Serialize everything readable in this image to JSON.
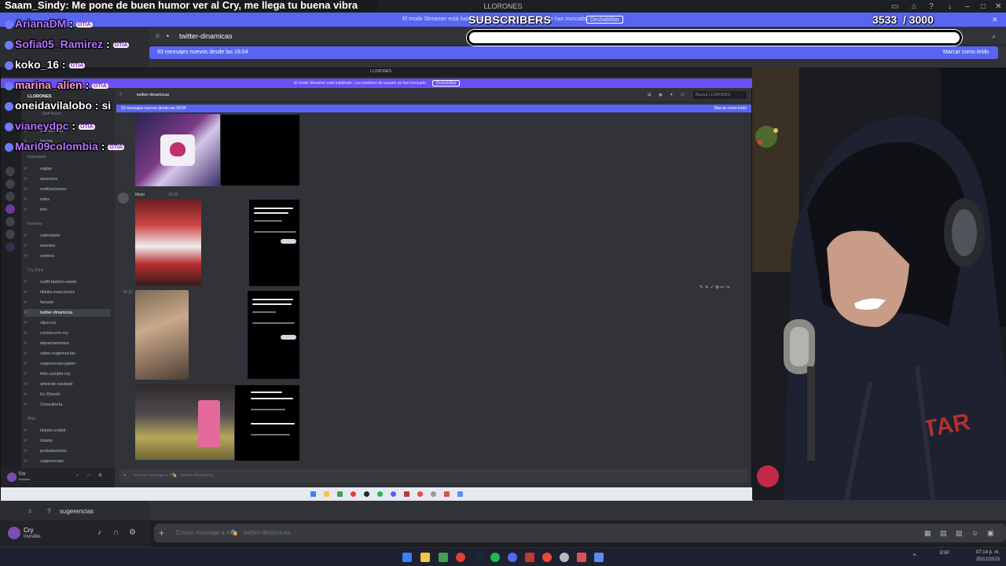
{
  "window": {
    "title": "LLORONES"
  },
  "outer": {
    "streamer_notice": "El modo Streamer está habilitado. Los nombres de usuario se han truncado.",
    "streamer_button": "Deshabilitar",
    "server_name": "LLORONES",
    "channel_header": "twitter-dinamicas",
    "new_messages": "93 mensajes nuevos desde las 18:04",
    "mark_read": "Marcar como leído",
    "sidebar_channel": "sugerencias",
    "user_name": "Cry",
    "user_status": "Invisible",
    "input_placeholder": "Enviar mensaje a #🎭 · twitter-dinamicas",
    "clock": "07:14 p. m.",
    "date": "25/12/2023",
    "lang": "ESP"
  },
  "inner": {
    "title": "LLORONES",
    "streamer_notice": "El modo Streamer está habilitado. Los nombres de usuario se han truncado.",
    "streamer_button": "Deshabilitar",
    "server_name": "LLORONES",
    "channel_header": "twitter-dinamicas",
    "search_placeholder": "Buscar LLORONES",
    "new_messages": "93 mensajes nuevos desde las 18:04",
    "mark_read": "Marcar como leído",
    "staff_room": "Staff Room",
    "channels_top": [
      "bienvenidas",
      "boosts"
    ],
    "cat_importante": "Importante",
    "channels_imp": [
      "reglas",
      "anuncios",
      "notificaciones",
      "roles",
      "info"
    ],
    "cat_eventos": "Eventos",
    "channels_ev": [
      "calendario",
      "eventos",
      "sorteos"
    ],
    "cat_cryzone": "Cry Zone",
    "channels_cz": [
      "outfit-fashion-week",
      "tiktoks-reacciones",
      "fanarts",
      "twitter-dinamicas",
      "clips-cry",
      "cocina-con-cry",
      "departamentos",
      "video-sugerencias",
      "sugerencias-japón",
      "feliz-cumple-cry",
      "árbol-de-navidad",
      "En Directo",
      "Consultoría"
    ],
    "cat_plus": "Plus",
    "channels_plus": [
      "tickets-crybot",
      "tickets",
      "postulaciones",
      "sugerencias"
    ],
    "author": "Nicki",
    "author_time": "18:30",
    "side_time": "18:31",
    "user_name": "Cry",
    "user_status": "Invisible",
    "input_placeholder": "Enviar mensaje a #🎭 · twitter-dinamicas"
  },
  "overlay": {
    "top_message": {
      "user": "Saam_Sindy",
      "text": ": Me pone de buen humor ver al Cry, me llega tu buena vibra"
    },
    "subs_label": "SUBSCRIBERS",
    "subs_current": "3533",
    "subs_goal": "/ 3000",
    "messages": [
      {
        "user": "ArianaDM",
        "text": " :",
        "color": "#b574ff"
      },
      {
        "user": "Sofia05_Ramirez",
        "text": " :",
        "color": "#b574ff"
      },
      {
        "user": "koko_16",
        "text": " :",
        "color": "#ffffff"
      },
      {
        "user": "marina_alien",
        "text": " :",
        "color": "#ff9bd6"
      },
      {
        "user": "oneidavilalobo",
        "text": " : si",
        "color": "#ffffff"
      },
      {
        "user": "vianeydpc",
        "text": " :",
        "color": "#b574ff"
      },
      {
        "user": "Mari09colombia",
        "text": " :",
        "color": "#b574ff"
      }
    ],
    "emote_label": "OTIA"
  },
  "colors": {
    "blurple": "#5865f2",
    "streamer": "#6a4ff5",
    "sidebar": "#2b2d31",
    "chat": "#313338"
  }
}
